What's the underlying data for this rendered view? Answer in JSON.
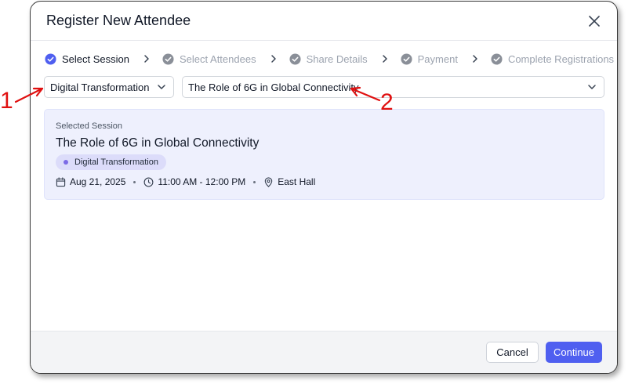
{
  "modal": {
    "title": "Register New Attendee"
  },
  "stepper": {
    "steps": [
      {
        "label": "Select Session",
        "state": "active"
      },
      {
        "label": "Select Attendees",
        "state": "pending"
      },
      {
        "label": "Share Details",
        "state": "pending"
      },
      {
        "label": "Payment",
        "state": "pending"
      },
      {
        "label": "Complete Registrations",
        "state": "pending"
      }
    ]
  },
  "filters": {
    "category_value": "Digital Transformation",
    "session_value": "The Role of 6G in Global Connectivity"
  },
  "selected_session": {
    "label": "Selected Session",
    "title": "The Role of 6G in Global Connectivity",
    "tag": "Digital Transformation",
    "date": "Aug 21, 2025",
    "time": "11:00 AM - 12:00 PM",
    "location": "East Hall"
  },
  "footer": {
    "cancel_label": "Cancel",
    "continue_label": "Continue"
  },
  "annotations": {
    "marker_1": "1",
    "marker_2": "2",
    "color": "#e01010"
  },
  "colors": {
    "accent": "#4f5ff0",
    "active_step": "#4f5ff0",
    "pending_step": "#8a8f98",
    "card_bg": "#eef0fd"
  },
  "icons": {
    "close": "close-icon",
    "step_active": "check-circle-filled-icon",
    "step_pending": "check-circle-icon",
    "chevron": "chevron-down-icon",
    "calendar": "calendar-icon",
    "clock": "clock-icon",
    "location": "map-pin-icon"
  }
}
